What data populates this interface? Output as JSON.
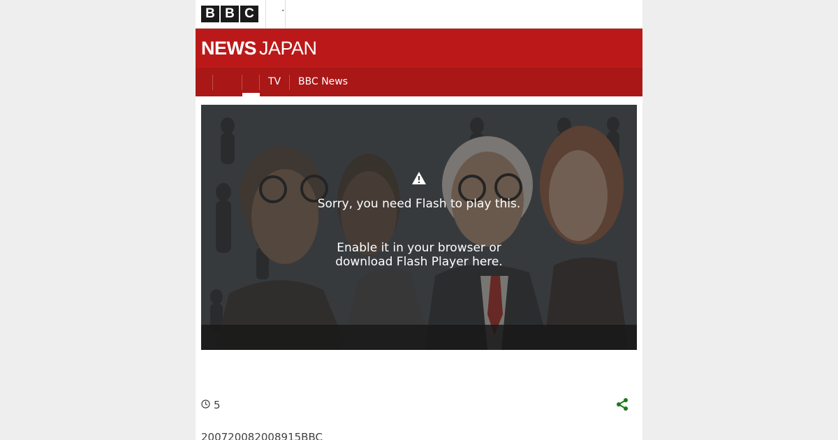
{
  "brand": {
    "bbc_letters": [
      "B",
      "B",
      "C"
    ],
    "news_word": "NEWS",
    "edition_word": "JAPAN",
    "header_color": "#bb1919"
  },
  "topbar": {
    "chevron": "˅",
    "icon": "chevron-down-icon"
  },
  "nav": {
    "items": [
      {
        "label": ""
      },
      {
        "label": ""
      },
      {
        "label": "TV"
      },
      {
        "label": "BBC News"
      }
    ]
  },
  "player": {
    "warning_icon": "warning-icon",
    "message_line1": "Sorry, you need Flash to play this.",
    "message_line2": "Enable it in your browser or download Flash Player here."
  },
  "meta": {
    "clock_icon": "clock-icon",
    "time_value": "5",
    "share_icon": "share-icon",
    "share_color": "#1b7a1b",
    "byline": "200720082008915BBC"
  }
}
